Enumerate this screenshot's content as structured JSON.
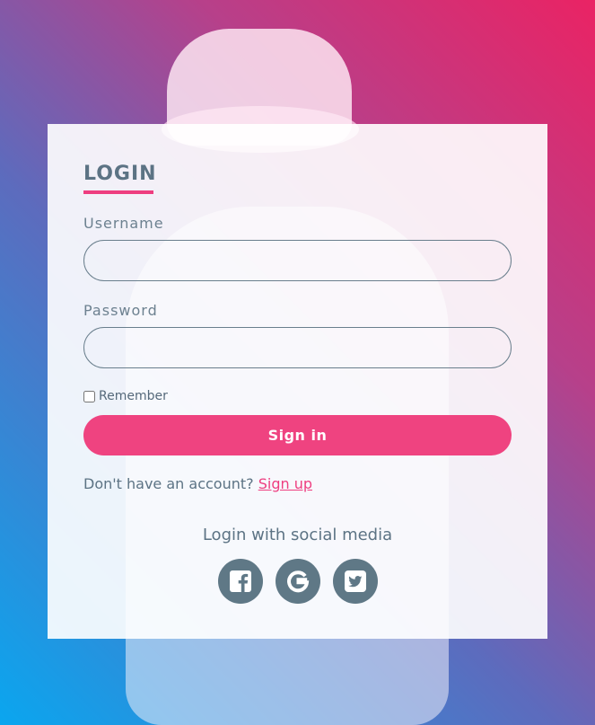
{
  "login": {
    "title": "LOGIN",
    "username_label": "Username",
    "username_value": "",
    "password_label": "Password",
    "password_value": "",
    "remember_label": "Remember",
    "remember_checked": false,
    "signin_label": "Sign in",
    "signup_prompt": "Don't have an account?",
    "signup_link": "Sign up",
    "social_title": "Login with social media",
    "social_icons": [
      "facebook-icon",
      "google-icon",
      "twitter-icon"
    ]
  },
  "colors": {
    "accent": "#ef4380",
    "text": "#5c7384",
    "social_button": "#5f7886",
    "gradient_start": "#0aa6ef",
    "gradient_end": "#ea2364"
  }
}
